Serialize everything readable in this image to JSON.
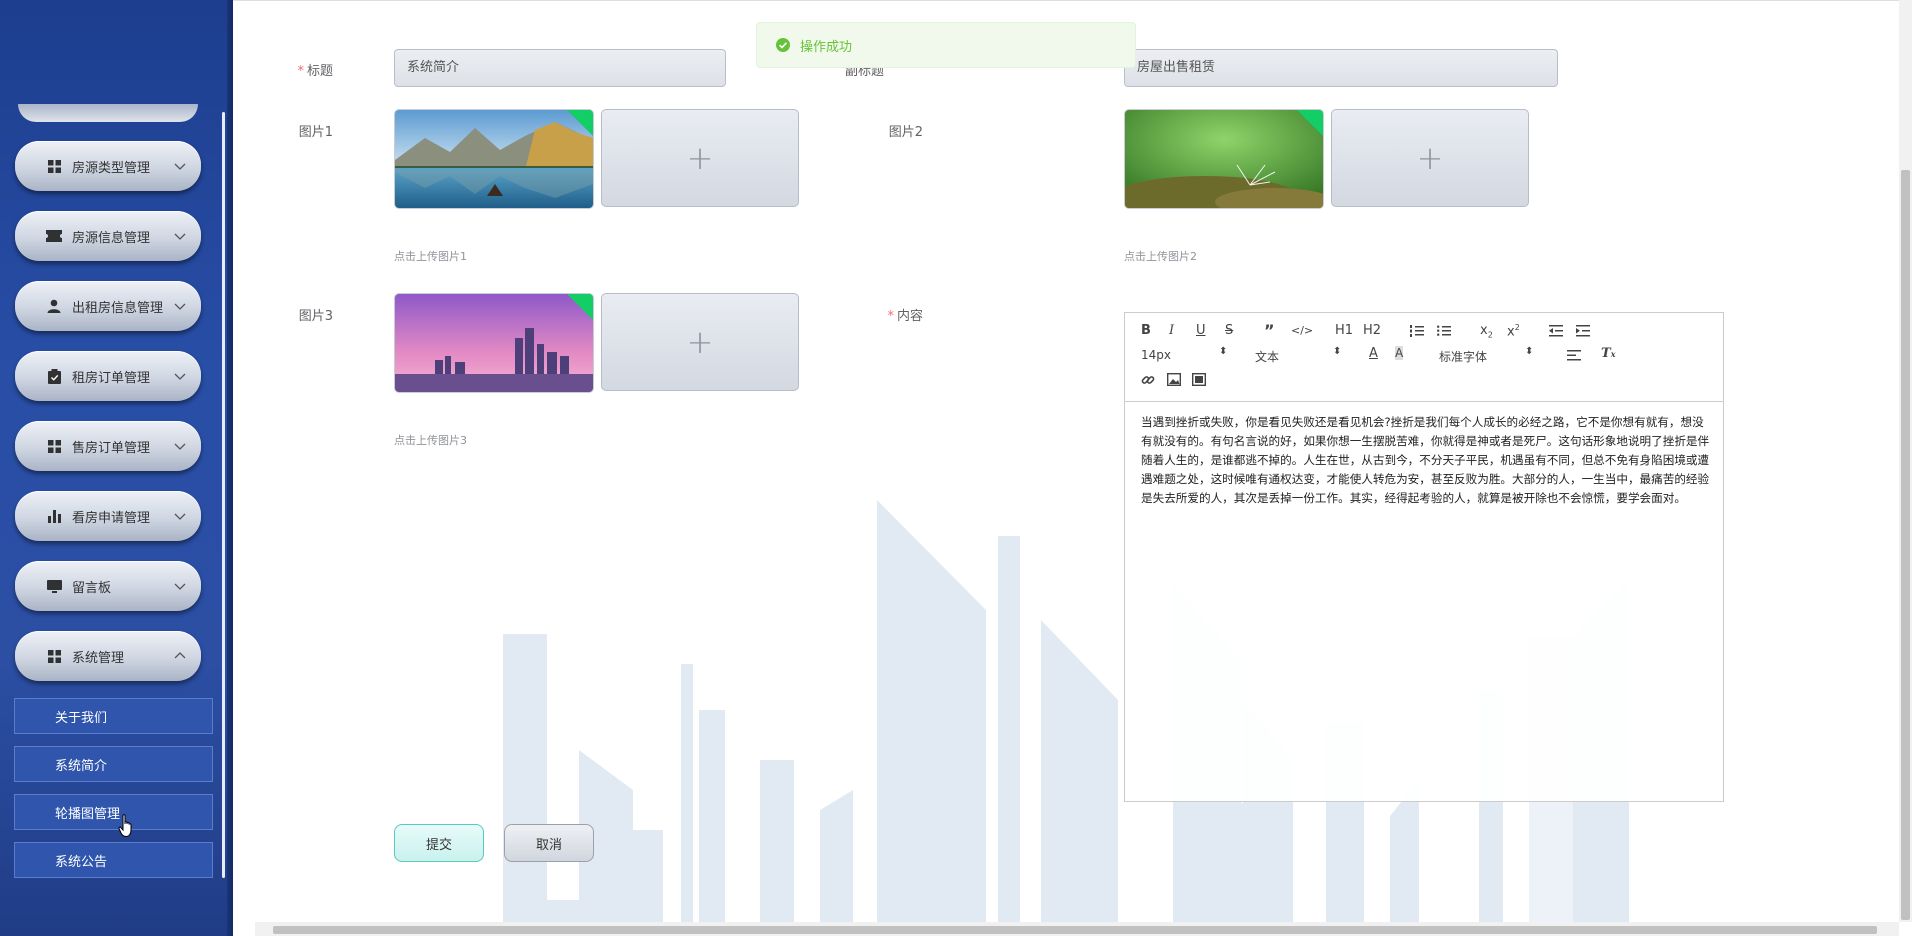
{
  "sidebar": {
    "menu": [
      {
        "label": "房源类型管理",
        "icon": "grid-icon"
      },
      {
        "label": "房源信息管理",
        "icon": "ticket-icon"
      },
      {
        "label": "出租房信息管理",
        "icon": "user-icon"
      },
      {
        "label": "租房订单管理",
        "icon": "clipboard-icon"
      },
      {
        "label": "售房订单管理",
        "icon": "grid-icon"
      },
      {
        "label": "看房申请管理",
        "icon": "bar-chart-icon"
      },
      {
        "label": "留言板",
        "icon": "monitor-icon"
      },
      {
        "label": "系统管理",
        "icon": "grid-icon"
      }
    ],
    "submenu": [
      "关于我们",
      "系统简介",
      "轮播图管理",
      "系统公告"
    ]
  },
  "toast": {
    "text": "操作成功",
    "color": "#67c23a"
  },
  "form": {
    "title_label": "标题",
    "title_value": "系统简介",
    "subtitle_label": "副标题",
    "subtitle_value": "房屋出售租赁",
    "picture1_label": "图片1",
    "picture1_tip": "点击上传图片1",
    "picture2_label": "图片2",
    "picture2_tip": "点击上传图片2",
    "picture3_label": "图片3",
    "picture3_tip": "点击上传图片3",
    "content_label": "内容",
    "content_text": "当遇到挫折或失败，你是看见失败还是看见机会?挫折是我们每个人成长的必经之路，它不是你想有就有，想没有就没有的。有句名言说的好，如果你想一生摆脱苦难，你就得是神或者是死尸。这句话形象地说明了挫折是伴随着人生的，是谁都逃不掉的。人生在世，从古到今，不分天子平民，机遇虽有不同，但总不免有身陷困境或遭遇难题之处，这时候唯有通权达变，才能使人转危为安，甚至反败为胜。大部分的人，一生当中，最痛苦的经验是失去所爱的人，其次是丢掉一份工作。其实，经得起考验的人，就算是被开除也不会惊慌，要学会面对。",
    "submit_label": "提交",
    "cancel_label": "取消"
  },
  "editor": {
    "font_size": "14px",
    "paragraph": "文本",
    "font_family": "标准字体",
    "h1": "H1",
    "h2": "H2"
  },
  "colors": {
    "required": "#f56c6c",
    "accent": "#57c9c1",
    "sidebar": "#284ea6"
  }
}
